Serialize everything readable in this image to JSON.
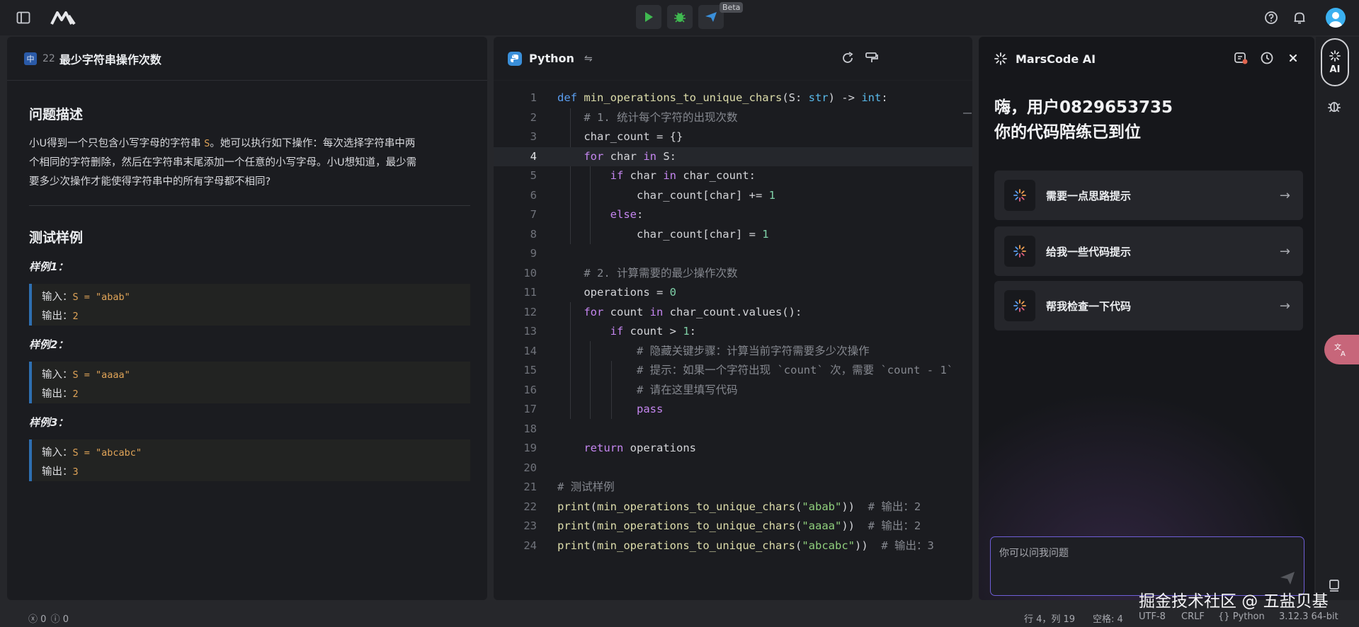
{
  "topbar": {
    "beta": "Beta"
  },
  "problem": {
    "lang_badge": "中",
    "number": "22",
    "title": "最少字符串操作次数",
    "section_desc": "问题描述",
    "desc_line1_a": "小U得到一个只包含小写字母的字符串 ",
    "desc_line1_code": "S",
    "desc_line1_b": "。她可以执行如下操作：每次选择字符串中两",
    "desc_line2": "个相同的字符删除，然后在字符串末尾添加一个任意的小写字母。小U想知道，最少需",
    "desc_line3": "要多少次操作才能使得字符串中的所有字母都不相同?",
    "section_tests": "测试样例",
    "examples": [
      {
        "title": "样例1：",
        "input_label": "输入：",
        "input": "S = \"abab\"",
        "output_label": "输出：",
        "output": "2"
      },
      {
        "title": "样例2：",
        "input_label": "输入：",
        "input": "S = \"aaaa\"",
        "output_label": "输出：",
        "output": "2"
      },
      {
        "title": "样例3：",
        "input_label": "输入：",
        "input": "S = \"abcabc\"",
        "output_label": "输出：",
        "output": "3"
      }
    ]
  },
  "editor": {
    "language": "Python",
    "active_line": 4,
    "lines": [
      {
        "n": "1",
        "code": "def min_operations_to_unique_chars(S: str) -> int:"
      },
      {
        "n": "2",
        "code": "    # 1. 统计每个字符的出现次数"
      },
      {
        "n": "3",
        "code": "    char_count = {}"
      },
      {
        "n": "4",
        "code": "    for char in S:"
      },
      {
        "n": "5",
        "code": "        if char in char_count:"
      },
      {
        "n": "6",
        "code": "            char_count[char] += 1"
      },
      {
        "n": "7",
        "code": "        else:"
      },
      {
        "n": "8",
        "code": "            char_count[char] = 1"
      },
      {
        "n": "9",
        "code": ""
      },
      {
        "n": "10",
        "code": "    # 2. 计算需要的最少操作次数"
      },
      {
        "n": "11",
        "code": "    operations = 0"
      },
      {
        "n": "12",
        "code": "    for count in char_count.values():"
      },
      {
        "n": "13",
        "code": "        if count > 1:"
      },
      {
        "n": "14",
        "code": "            # 隐藏关键步骤：计算当前字符需要多少次操作"
      },
      {
        "n": "15",
        "code": "            # 提示：如果一个字符出现 `count` 次，需要 `count - 1`"
      },
      {
        "n": "16",
        "code": "            # 请在这里填写代码"
      },
      {
        "n": "17",
        "code": "            pass"
      },
      {
        "n": "18",
        "code": ""
      },
      {
        "n": "19",
        "code": "    return operations"
      },
      {
        "n": "20",
        "code": ""
      },
      {
        "n": "21",
        "code": "# 测试样例"
      },
      {
        "n": "22",
        "code": "print(min_operations_to_unique_chars(\"abab\"))  # 输出：2"
      },
      {
        "n": "23",
        "code": "print(min_operations_to_unique_chars(\"aaaa\"))  # 输出：2"
      },
      {
        "n": "24",
        "code": "print(min_operations_to_unique_chars(\"abcabc\"))  # 输出：3"
      }
    ]
  },
  "ai": {
    "title": "MarsCode AI",
    "greet_line1": "嗨，用户0829653735",
    "greet_line2": "你的代码陪练已到位",
    "suggestions": [
      "需要一点思路提示",
      "给我一些代码提示",
      "帮我检查一下代码"
    ],
    "input_placeholder": "你可以问我问题",
    "rail_ai": "AI"
  },
  "status": {
    "errors": "0",
    "warnings": "0",
    "position": "行 4，列 19",
    "spaces": "空格: 4",
    "encoding": "UTF-8",
    "eol": "CRLF",
    "language": "Python",
    "interpreter": "3.12.3 64-bit"
  },
  "watermark": "掘金技术社区 @ 五盐贝基",
  "colors": {
    "accent": "#6f5fd8",
    "run_green": "#3fb950",
    "ai_blue": "#3a8fd9",
    "example_bar": "#2e6fb1"
  }
}
